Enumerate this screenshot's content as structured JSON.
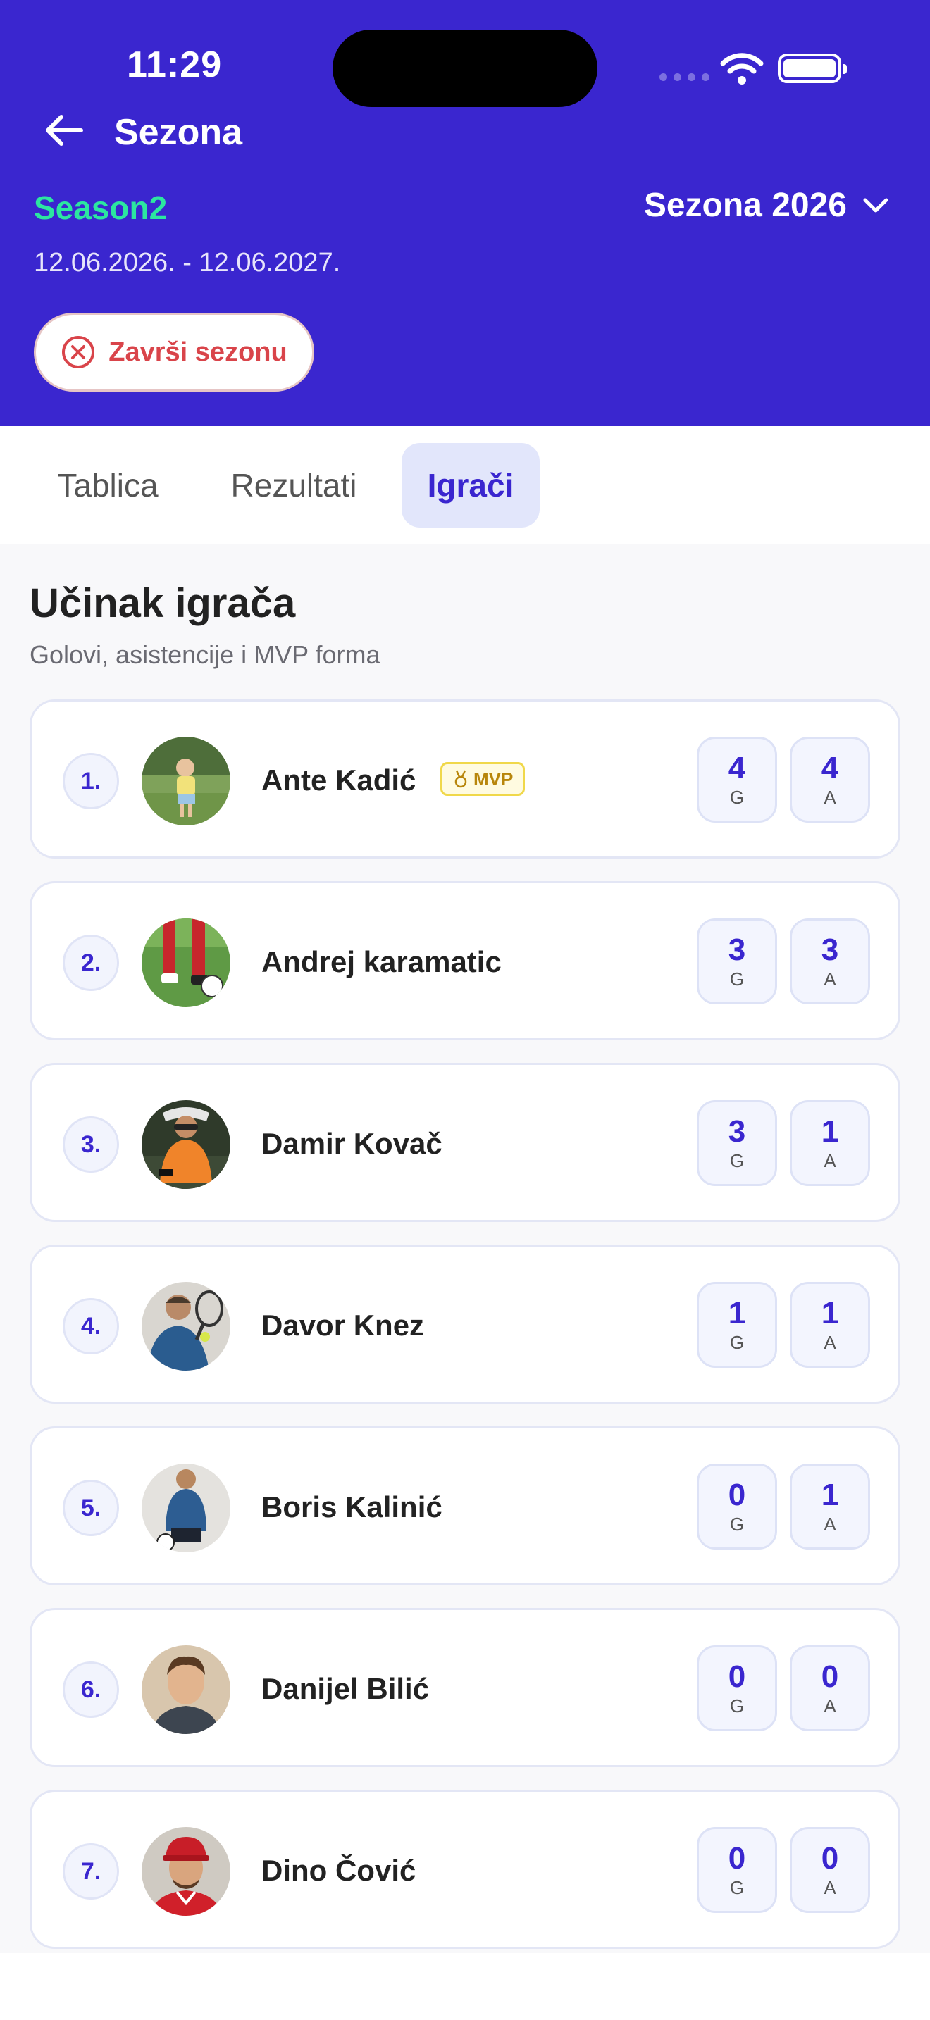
{
  "status_bar": {
    "time": "11:29"
  },
  "header": {
    "title": "Sezona",
    "season_name": "Season2",
    "season_dates": "12.06.2026. - 12.06.2027.",
    "season_selector": "Sezona 2026",
    "end_season_label": "Završi sezonu"
  },
  "tabs": [
    {
      "label": "Tablica",
      "active": false
    },
    {
      "label": "Rezultati",
      "active": false
    },
    {
      "label": "Igrači",
      "active": true
    }
  ],
  "section": {
    "title": "Učinak igrača",
    "subtitle": "Golovi, asistencije i MVP forma"
  },
  "players": [
    {
      "rank": "1.",
      "name": "Ante Kadić",
      "mvp": "MVP",
      "goals": "4",
      "goals_label": "G",
      "assists": "4",
      "assists_label": "A"
    },
    {
      "rank": "2.",
      "name": "Andrej karamatic",
      "goals": "3",
      "goals_label": "G",
      "assists": "3",
      "assists_label": "A"
    },
    {
      "rank": "3.",
      "name": "Damir Kovač",
      "goals": "3",
      "goals_label": "G",
      "assists": "1",
      "assists_label": "A"
    },
    {
      "rank": "4.",
      "name": "Davor Knez",
      "goals": "1",
      "goals_label": "G",
      "assists": "1",
      "assists_label": "A"
    },
    {
      "rank": "5.",
      "name": "Boris Kalinić",
      "goals": "0",
      "goals_label": "G",
      "assists": "1",
      "assists_label": "A"
    },
    {
      "rank": "6.",
      "name": "Danijel Bilić",
      "goals": "0",
      "goals_label": "G",
      "assists": "0",
      "assists_label": "A"
    },
    {
      "rank": "7.",
      "name": "Dino Čović",
      "goals": "0",
      "goals_label": "G",
      "assists": "0",
      "assists_label": "A"
    }
  ],
  "colors": {
    "header_bg": "#3a26cf",
    "season_name": "#2ce6a0",
    "danger": "#d9444a",
    "accent": "#3a26cf"
  }
}
